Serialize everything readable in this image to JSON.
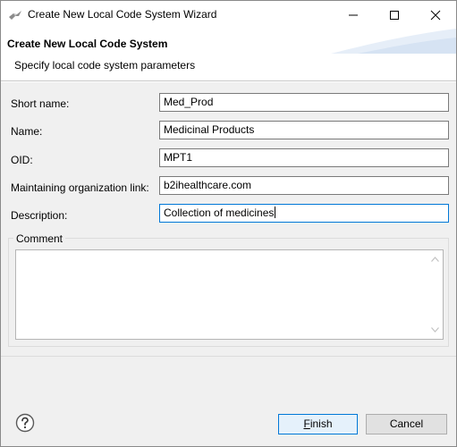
{
  "window": {
    "title": "Create New Local Code System Wizard",
    "controls": {
      "minimize": "minimize-icon",
      "maximize": "maximize-icon",
      "close": "close-icon"
    }
  },
  "header": {
    "title": "Create New Local Code System",
    "description": "Specify local code system parameters"
  },
  "form": {
    "short_name": {
      "label": "Short name:",
      "value": "Med_Prod"
    },
    "name": {
      "label": "Name:",
      "value": "Medicinal Products"
    },
    "oid": {
      "label": "OID:",
      "value": "MPT1"
    },
    "maintaining_org": {
      "label": "Maintaining organization link:",
      "value": "b2ihealthcare.com"
    },
    "description": {
      "label": "Description:",
      "value": "Collection of medicines"
    },
    "comment": {
      "label": "Comment",
      "value": ""
    }
  },
  "footer": {
    "help_icon": "help-icon",
    "finish_mnemonic": "F",
    "finish_rest": "inish",
    "cancel_label": "Cancel"
  },
  "colors": {
    "accent": "#0078d7",
    "dialog_bg": "#f0f0f0",
    "banner_bg": "#ffffff"
  }
}
